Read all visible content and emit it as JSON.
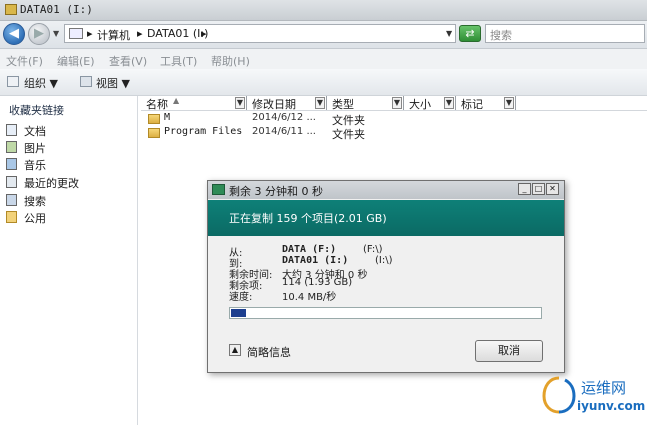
{
  "window": {
    "title": "DATA01 (I:)"
  },
  "address": {
    "crumbs": [
      "计算机",
      "DATA01 (I:)"
    ],
    "search_placeholder": "搜索"
  },
  "menu": [
    "文件(F)",
    "编辑(E)",
    "查看(V)",
    "工具(T)",
    "帮助(H)"
  ],
  "toolbar": {
    "organize": "组织",
    "views": "视图"
  },
  "sidebar": {
    "heading": "收藏夹链接",
    "items": [
      "文档",
      "图片",
      "音乐",
      "最近的更改",
      "搜索",
      "公用"
    ]
  },
  "columns": [
    "名称",
    "修改日期",
    "类型",
    "大小",
    "标记"
  ],
  "files": [
    {
      "name": "M",
      "date": "2014/6/12 ...",
      "type": "文件夹"
    },
    {
      "name": "Program Files",
      "date": "2014/6/11 ...",
      "type": "文件夹"
    }
  ],
  "dialog": {
    "title": "剩余 3 分钟和 0 秒",
    "header": "正在复制 159 个项目(2.01 GB)",
    "rows": [
      {
        "key": "从:",
        "name": "DATA (F:)",
        "path": "(F:\\)"
      },
      {
        "key": "到:",
        "name": "DATA01 (I:)",
        "path": "(I:\\)"
      }
    ],
    "time_key": "剩余时间:",
    "time_val": "大约 3 分钟和 0 秒",
    "items_key": "剩余项:",
    "items_val": "114 (1.93 GB)",
    "speed_key": "速度:",
    "speed_val": "10.4 MB/秒",
    "progress": 0.05,
    "more": "简略信息",
    "cancel": "取消"
  },
  "watermark": {
    "brand": "运维网",
    "site": "iyunv.com"
  }
}
